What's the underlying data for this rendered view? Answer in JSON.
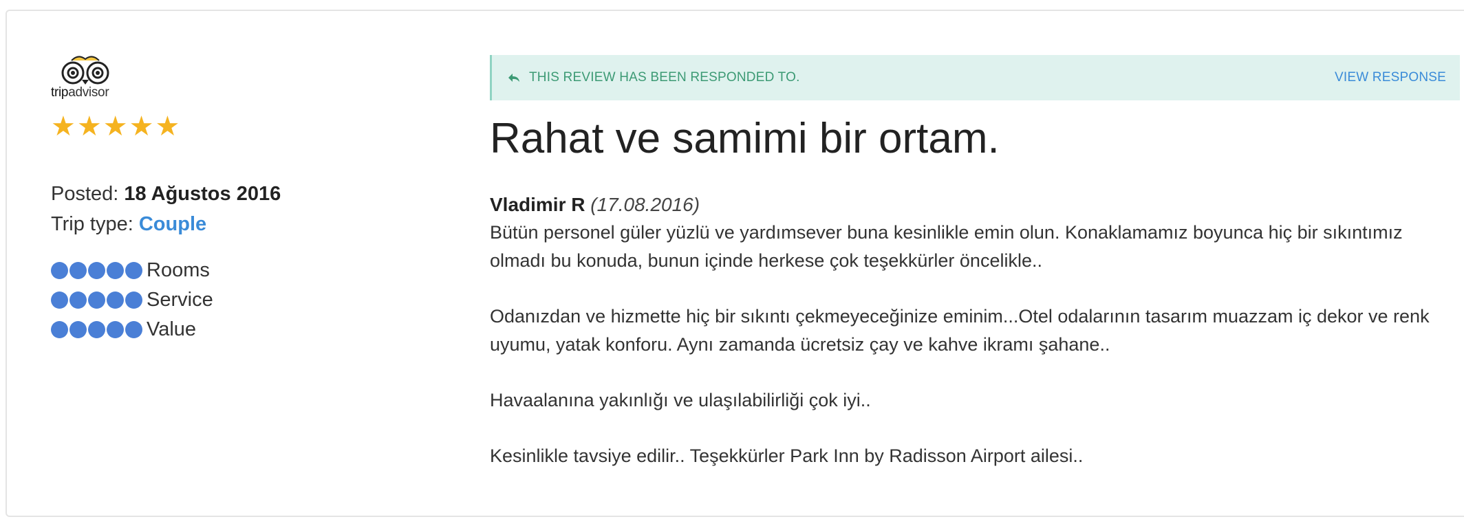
{
  "logo": {
    "word_trip": "trip",
    "word_advisor": "advisor"
  },
  "rating": {
    "stars": 5,
    "star_color": "#f5b320"
  },
  "posted": {
    "label": "Posted:",
    "value": "18 Ağustos 2016"
  },
  "trip_type": {
    "label": "Trip type:",
    "value": "Couple"
  },
  "sub_ratings": [
    {
      "label": "Rooms",
      "bubbles": 5
    },
    {
      "label": "Service",
      "bubbles": 5
    },
    {
      "label": "Value",
      "bubbles": 5
    }
  ],
  "response": {
    "notice": "THIS REVIEW HAS BEEN RESPONDED TO.",
    "link": "VIEW RESPONSE"
  },
  "review": {
    "title": "Rahat ve samimi bir ortam.",
    "author": "Vladimir R",
    "date": "(17.08.2016)",
    "paragraphs": [
      "Bütün personel güler yüzlü ve yardımsever buna kesinlikle emin olun. Konaklamamız boyunca hiç bir sıkıntımız olmadı bu konuda, bunun içinde herkese çok teşekkürler öncelikle..",
      "Odanızdan ve hizmette hiç bir sıkıntı çekmeyeceğinize eminim...Otel odalarının tasarım muazzam iç dekor ve renk uyumu, yatak konforu. Aynı zamanda ücretsiz çay ve kahve ikramı şahane..",
      "Havaalanına yakınlığı ve ulaşılabilirliği çok iyi..",
      "Kesinlikle tavsiye edilir.. Teşekkürler Park Inn by Radisson Airport ailesi.."
    ]
  },
  "colors": {
    "accent_blue": "#3a8bd8",
    "bubble_blue": "#4a7fd6",
    "response_bg": "#dff2ee",
    "response_text": "#3c9a74"
  }
}
